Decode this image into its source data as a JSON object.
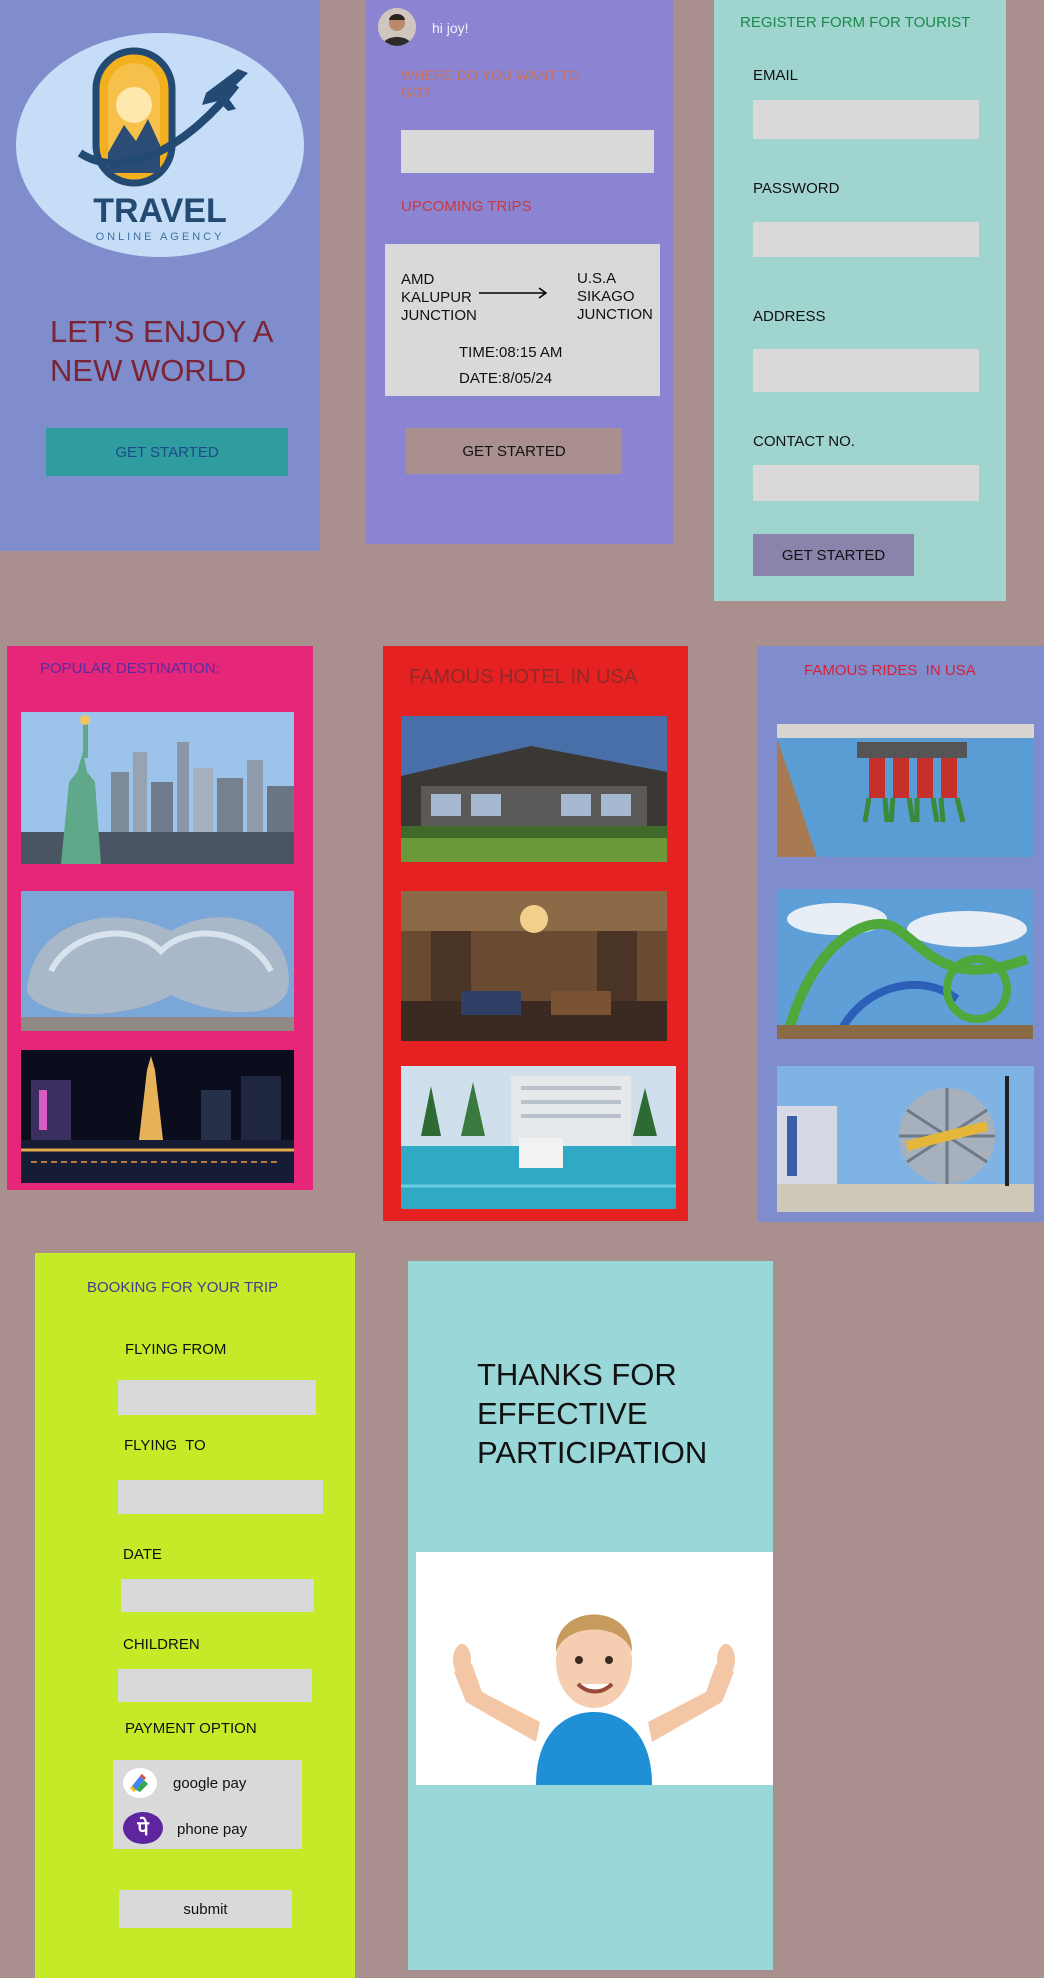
{
  "colors": {
    "background": "#a98f8e",
    "home_panel": "#7f8dcc",
    "trips_panel": "#8a84d2",
    "register_panel": "#9fd4cf",
    "popular_panel": "#e52679",
    "hotel_panel": "#e52121",
    "rides_panel": "#7f8dcc",
    "booking_panel": "#c4ea28",
    "thanks_panel": "#9ad7d9"
  },
  "home": {
    "logo": {
      "title": "TRAVEL",
      "subtitle": "ONLINE AGENCY"
    },
    "headline": "LET’S ENJOY A NEW WORLD",
    "button": "GET STARTED"
  },
  "trips": {
    "greeting": "hi joy!",
    "question": "WHERE DO YOU WANT TO GO?",
    "search_value": "",
    "upcoming_title": "UPCOMING TRIPS",
    "trip": {
      "from": "AMD KALUPUR JUNCTION",
      "to": "U.S.A SIKAGO JUNCTION",
      "time": "TIME:08:15 AM",
      "date": "DATE:8/05/24"
    },
    "button": "GET STARTED"
  },
  "register": {
    "title": "REGISTER FORM FOR TOURIST",
    "fields": [
      {
        "label": "EMAIL",
        "value": ""
      },
      {
        "label": "PASSWORD",
        "value": ""
      },
      {
        "label": "ADDRESS",
        "value": ""
      },
      {
        "label": "CONTACT NO.",
        "value": ""
      }
    ],
    "button": "GET STARTED"
  },
  "popular": {
    "title": "POPULAR DESTINATION:",
    "images": [
      "statue-of-liberty-photo",
      "cloud-gate-bean-photo",
      "las-vegas-night-photo"
    ]
  },
  "hotels": {
    "title": "FAMOUS HOTEL IN USA",
    "images": [
      "hotel-exterior-photo",
      "hotel-lobby-photo",
      "hotel-pool-photo"
    ]
  },
  "rides": {
    "title": "FAMOUS RIDES  IN USA",
    "images": [
      "drop-ride-photo",
      "roller-coaster-photo",
      "universal-globe-photo"
    ]
  },
  "booking": {
    "title": "BOOKING FOR YOUR TRIP",
    "fields": [
      {
        "label": "FLYING FROM",
        "value": ""
      },
      {
        "label": "FLYING  TO",
        "value": ""
      },
      {
        "label": "DATE",
        "value": ""
      },
      {
        "label": "CHILDREN",
        "value": ""
      }
    ],
    "payment_label": "PAYMENT OPTION",
    "payment_options": [
      {
        "name": "google pay",
        "icon": "google-pay-icon"
      },
      {
        "name": "phone pay",
        "icon": "phonepe-icon"
      }
    ],
    "submit": "submit"
  },
  "thanks": {
    "message": "THANKS FOR EFFECTIVE PARTICIPATION",
    "image": "thumbs-up-boy-photo"
  }
}
